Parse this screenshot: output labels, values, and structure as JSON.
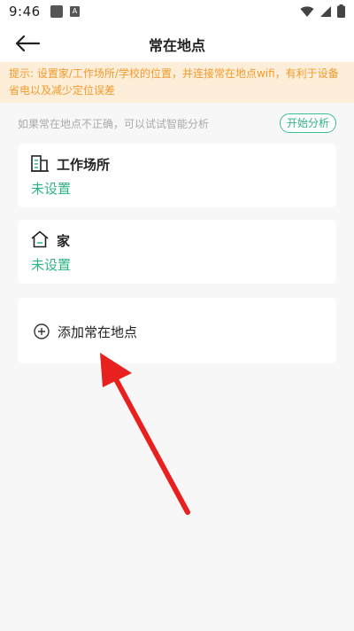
{
  "status_bar": {
    "time": "9:46",
    "notification_badge": "A",
    "icons": [
      "wifi-icon",
      "signal-icon",
      "battery-icon"
    ]
  },
  "header": {
    "title": "常在地点",
    "back_icon": "back-arrow-icon"
  },
  "tip": {
    "text": "提示: 设置家/工作场所/学校的位置，并连接常在地点wifi，有利于设备省电以及减少定位误差"
  },
  "hint": {
    "text": "如果常在地点不正确，可以试试智能分析",
    "button_label": "开始分析"
  },
  "places": [
    {
      "icon": "building-icon",
      "name": "工作场所",
      "status": "未设置"
    },
    {
      "icon": "home-icon",
      "name": "家",
      "status": "未设置"
    }
  ],
  "add_place": {
    "icon": "plus-circle-icon",
    "label": "添加常在地点"
  },
  "colors": {
    "accent": "#2fb383",
    "tip_background": "#fdeed9",
    "tip_text": "#f39a2b",
    "annotation_arrow": "#e8201f",
    "page_background": "#f7f7f7"
  }
}
